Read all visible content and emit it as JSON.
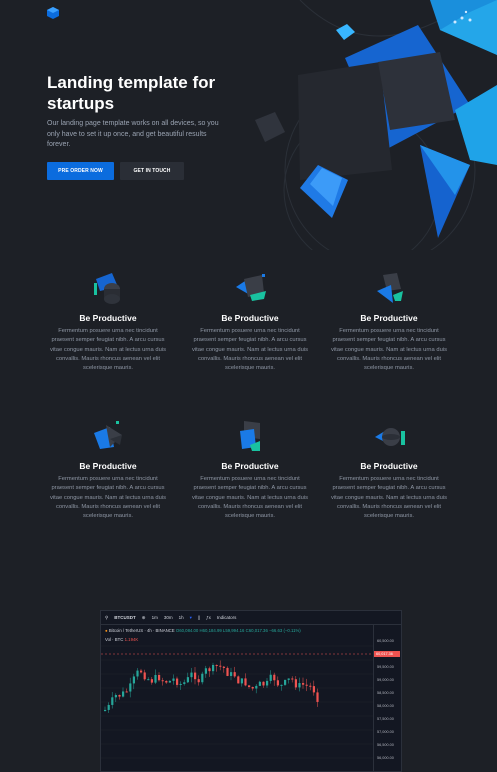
{
  "hero": {
    "title": "Landing template for startups",
    "body": "Our landing page template works on all devices, so you only have to set it up once, and get beautiful results forever.",
    "primary_button": "PRE ORDER NOW",
    "secondary_button": "GET IN TOUCH"
  },
  "features": [
    {
      "title": "Be Productive",
      "body": "Fermentum posuere urna nec tincidunt praesent semper feugiat nibh. A arcu cursus vitae congue mauris. Nam at lectus urna duis convallis. Mauris rhoncus aenean vel elit scelerisque mauris.",
      "icon": "cylinder-icon"
    },
    {
      "title": "Be Productive",
      "body": "Fermentum posuere urna nec tincidunt praesent semper feugiat nibh. A arcu cursus vitae congue mauris. Nam at lectus urna duis convallis. Mauris rhoncus aenean vel elit scelerisque mauris.",
      "icon": "diamond-icon"
    },
    {
      "title": "Be Productive",
      "body": "Fermentum posuere urna nec tincidunt praesent semper feugiat nibh. A arcu cursus vitae congue mauris. Nam at lectus urna duis convallis. Mauris rhoncus aenean vel elit scelerisque mauris.",
      "icon": "cube-icon"
    },
    {
      "title": "Be Productive",
      "body": "Fermentum posuere urna nec tincidunt praesent semper feugiat nibh. A arcu cursus vitae congue mauris. Nam at lectus urna duis convallis. Mauris rhoncus aenean vel elit scelerisque mauris.",
      "icon": "pyramid-icon"
    },
    {
      "title": "Be Productive",
      "body": "Fermentum posuere urna nec tincidunt praesent semper feugiat nibh. A arcu cursus vitae congue mauris. Nam at lectus urna duis convallis. Mauris rhoncus aenean vel elit scelerisque mauris.",
      "icon": "cube-blue-icon"
    },
    {
      "title": "Be Productive",
      "body": "Fermentum posuere urna nec tincidunt praesent semper feugiat nibh. A arcu cursus vitae congue mauris. Nam at lectus urna duis convallis. Mauris rhoncus aenean vel elit scelerisque mauris.",
      "icon": "sphere-icon"
    }
  ],
  "widget": {
    "symbol": "BTCUSDT",
    "intervals": [
      "1m",
      "30m",
      "1h"
    ],
    "indicators_label": "Indicators",
    "title_line": "Bitcoin / TetherUS · 4h · BINANCE",
    "ohlc": "O60,084.00 H60,184.99 L59,994.16 C60,017.36 −66.63 (−0.11%)",
    "vol_label": "Vol · BTC",
    "vol_value": "1.194K",
    "price_tag": "60,017.36",
    "price_axis": [
      "60,500.00",
      "60,000.00",
      "59,500.00",
      "59,000.00",
      "58,500.00",
      "58,000.00",
      "57,500.00",
      "57,000.00",
      "56,500.00",
      "56,000.00"
    ]
  },
  "colors": {
    "accent": "#0b6cde",
    "bg": "#1d2026",
    "up": "#26a69a",
    "down": "#ef5350"
  }
}
